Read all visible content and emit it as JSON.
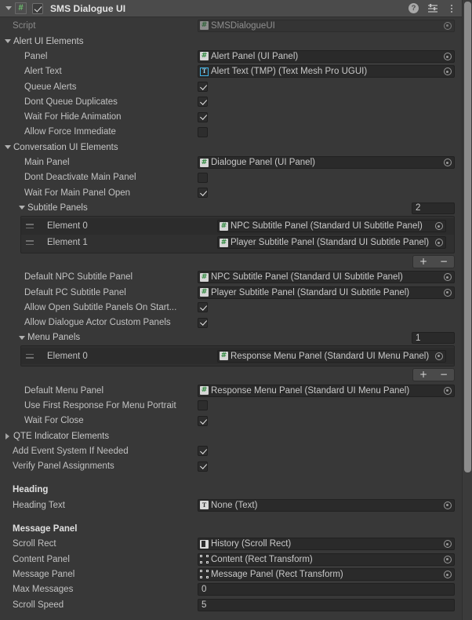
{
  "component": {
    "title": "SMS Dialogue UI",
    "script_icon": "#",
    "enabled": true,
    "help_icon": "?",
    "preset_icon": "preset-icon",
    "menu_icon": "kebab-icon"
  },
  "script_row": {
    "label": "Script",
    "value": "SMSDialogueUI"
  },
  "sections": {
    "alert": {
      "label": "Alert UI Elements",
      "expanded": true,
      "fields": [
        {
          "label": "Panel",
          "type": "object",
          "icon": "gameobject-icon",
          "value": "Alert Panel (UI Panel)"
        },
        {
          "label": "Alert Text",
          "type": "object",
          "icon": "tmp-icon",
          "value": "Alert Text (TMP) (Text Mesh Pro UGUI)"
        },
        {
          "label": "Queue Alerts",
          "type": "checkbox",
          "value": true
        },
        {
          "label": "Dont Queue Duplicates",
          "type": "checkbox",
          "value": true
        },
        {
          "label": "Wait For Hide Animation",
          "type": "checkbox",
          "value": true
        },
        {
          "label": "Allow Force Immediate",
          "type": "checkbox",
          "value": false
        }
      ]
    },
    "conversation": {
      "label": "Conversation UI Elements",
      "expanded": true,
      "main_panel": {
        "label": "Main Panel",
        "icon": "gameobject-icon",
        "value": "Dialogue Panel (UI Panel)"
      },
      "dont_deactivate": {
        "label": "Dont Deactivate Main Panel",
        "value": false
      },
      "wait_open": {
        "label": "Wait For Main Panel Open",
        "value": true
      },
      "subtitle_panels": {
        "label": "Subtitle Panels",
        "size": "2",
        "elements": [
          {
            "label": "Element 0",
            "icon": "gameobject-icon",
            "value": "NPC Subtitle Panel (Standard UI Subtitle Panel)"
          },
          {
            "label": "Element 1",
            "icon": "gameobject-icon",
            "value": "Player Subtitle Panel (Standard UI Subtitle Panel)"
          }
        ],
        "add_label": "+",
        "remove_label": "−"
      },
      "default_npc": {
        "label": "Default NPC Subtitle Panel",
        "icon": "gameobject-icon",
        "value": "NPC Subtitle Panel (Standard UI Subtitle Panel)"
      },
      "default_pc": {
        "label": "Default PC Subtitle Panel",
        "icon": "gameobject-icon",
        "value": "Player Subtitle Panel (Standard UI Subtitle Panel)"
      },
      "allow_open_on_start": {
        "label": "Allow Open Subtitle Panels On Start...",
        "value": true
      },
      "allow_actor_custom": {
        "label": "Allow Dialogue Actor Custom Panels",
        "value": true
      },
      "menu_panels": {
        "label": "Menu Panels",
        "size": "1",
        "elements": [
          {
            "label": "Element 0",
            "icon": "gameobject-icon",
            "value": "Response Menu Panel (Standard UI Menu Panel)"
          }
        ],
        "add_label": "+",
        "remove_label": "−"
      },
      "default_menu": {
        "label": "Default Menu Panel",
        "icon": "gameobject-icon",
        "value": "Response Menu Panel (Standard UI Menu Panel)"
      },
      "use_first_response": {
        "label": "Use First Response For Menu Portrait",
        "value": false
      },
      "wait_for_close": {
        "label": "Wait For Close",
        "value": true
      }
    },
    "qte": {
      "label": "QTE Indicator Elements",
      "expanded": false
    }
  },
  "root_fields": [
    {
      "label": "Add Event System If Needed",
      "value": true
    },
    {
      "label": "Verify Panel Assignments",
      "value": true
    }
  ],
  "heading_group": {
    "header": "Heading",
    "field": {
      "label": "Heading Text",
      "icon": "text-icon",
      "value": "None (Text)"
    }
  },
  "message_panel_group": {
    "header": "Message Panel",
    "fields": [
      {
        "label": "Scroll Rect",
        "type": "object",
        "icon": "scrollrect-icon",
        "value": "History (Scroll Rect)"
      },
      {
        "label": "Content Panel",
        "type": "object",
        "icon": "recttransform-icon",
        "value": "Content (Rect Transform)"
      },
      {
        "label": "Message Panel",
        "type": "object",
        "icon": "recttransform-icon",
        "value": "Message Panel (Rect Transform)"
      },
      {
        "label": "Max Messages",
        "type": "number",
        "value": "0"
      },
      {
        "label": "Scroll Speed",
        "type": "number",
        "value": "5"
      }
    ]
  },
  "colors": {
    "background": "#383838",
    "header_bg": "#4b4b4b",
    "field_bg": "#2a2a2a",
    "accent_green": "#2f8a3f",
    "accent_blue": "#3fb3e8",
    "text": "#c2c2c2"
  }
}
